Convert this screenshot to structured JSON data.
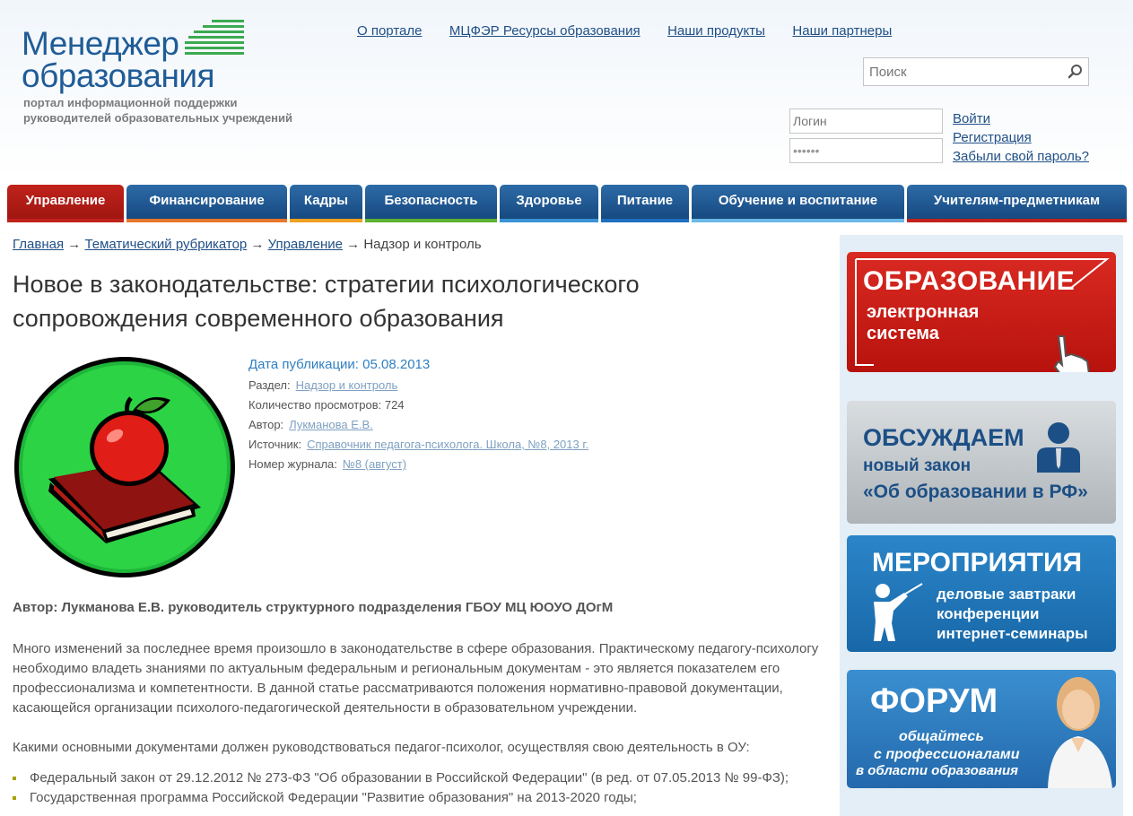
{
  "header": {
    "logo_line1": "Менеджер",
    "logo_line2": "образования",
    "logo_tagline_1": "портал информационной поддержки",
    "logo_tagline_2": "руководителей образовательных учреждений",
    "top_links": [
      "О портале",
      "МЦФЭР Ресурсы образования",
      "Наши продукты",
      "Наши партнеры"
    ],
    "search_placeholder": "Поиск",
    "login_placeholder": "Логин",
    "password_value": "••••••",
    "login_link": "Войти",
    "register_link": "Регистрация",
    "forgot_link": "Забыли свой пароль?"
  },
  "nav": {
    "tabs": [
      {
        "label": "Управление",
        "bar": "#c0221b"
      },
      {
        "label": "Финансирование",
        "bar": "#e8772b"
      },
      {
        "label": "Кадры",
        "bar": "#f0a020"
      },
      {
        "label": "Безопасность",
        "bar": "#5cb233"
      },
      {
        "label": "Здоровье",
        "bar": "#3a93d5"
      },
      {
        "label": "Питание",
        "bar": "#1f6fc0"
      },
      {
        "label": "Обучение и воспитание",
        "bar": "#6ab8e6"
      },
      {
        "label": "Учителям-предметникам",
        "bar": "#c0221b"
      }
    ]
  },
  "breadcrumb": {
    "home": "Главная",
    "rubricator": "Тематический рубрикатор",
    "section": "Управление",
    "current": "Надзор и контроль",
    "sep": "→"
  },
  "article": {
    "title": "Новое в законодательстве: стратегии психологического сопровождения современного образования",
    "date": "Дата публикации: 05.08.2013",
    "section_label": "Раздел:",
    "section_value": "Надзор и контроль",
    "views": "Количество просмотров: 724",
    "author_label": "Автор:",
    "author_value": "Лукманова Е.В.",
    "source_label": "Источник:",
    "source_value": "Справочник педагога-психолога. Школа, №8, 2013 г.",
    "issue_label": "Номер журнала:",
    "issue_value": "№8 (август)",
    "author_line": "Автор: Лукманова Е.В. руководитель структурного подразделения ГБОУ МЦ ЮОУО ДОгМ",
    "paragraph1": "Много изменений за последнее время произошло в законодательстве в сфере образования. Практическому педагогу-психологу необходимо владеть знаниями по актуальным федеральным и региональным документам - это является показателем его профессионализма и компетентности. В данной статье рассматриваются положения нормативно-правовой документации, касающейся организации психолого-педагогической деятельности в образовательном учреждении.",
    "paragraph2": "Какими основными документами должен руководствоваться педагог-психолог, осуществляя свою деятельность в ОУ:",
    "bullets": [
      "Федеральный закон от 29.12.2012 № 273-ФЗ \"Об образовании в Российской Федерации\" (в ред. от 07.05.2013 № 99-ФЗ);",
      "Государственная программа Российской Федерации \"Развитие образования\" на 2013-2020 годы;"
    ]
  },
  "sidebar": {
    "b1_line1": "ОБРАЗОВАНИЕ",
    "b1_line2": "электронная",
    "b1_line3": "система",
    "b2_line1": "ОБСУЖДАЕМ",
    "b2_line2": "новый закон",
    "b2_line3": "«Об образовании в РФ»",
    "b3_line1": "МЕРОПРИЯТИЯ",
    "b3_line2": "деловые завтраки",
    "b3_line3": "конференции",
    "b3_line4": "интернет-семинары",
    "b4_line1": "ФОРУМ",
    "b4_line2": "общайтесь",
    "b4_line3": "с профессионалами",
    "b4_line4": "в области образования"
  }
}
